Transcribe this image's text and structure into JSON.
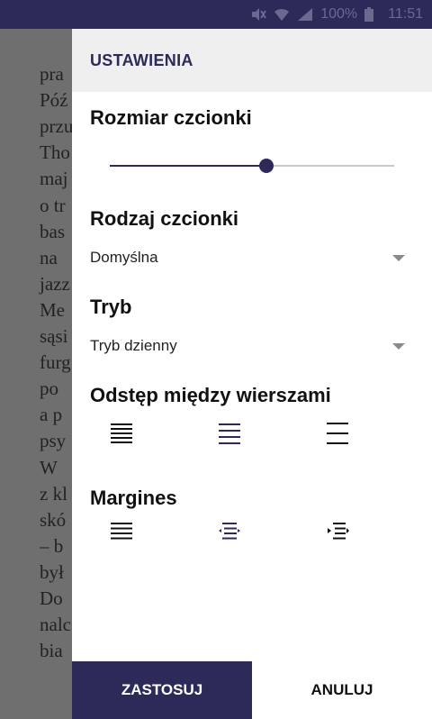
{
  "status_bar": {
    "battery": "100%",
    "time": "11:51"
  },
  "book": {
    "lines": [
      "pra",
      "Póź",
      "przu",
      "Tho",
      "maj",
      "o tr",
      "bas",
      "na",
      "jazz",
      "Me",
      "sąsi",
      "furg",
      "po",
      "a p",
      "psy",
      " W",
      "z kl",
      "skó",
      "– b",
      "był",
      "Do",
      "nalc",
      "bia"
    ]
  },
  "dialog": {
    "title": "USTAWIENIA",
    "font_size": {
      "label": "Rozmiar czcionki",
      "value_fraction": 0.55
    },
    "font_type": {
      "label": "Rodzaj czcionki",
      "selected": "Domyślna"
    },
    "mode": {
      "label": "Tryb",
      "selected": "Tryb dzienny"
    },
    "line_spacing": {
      "label": "Odstęp między wierszami",
      "options": [
        "line-spacing-small-icon",
        "line-spacing-medium-icon",
        "line-spacing-large-icon"
      ]
    },
    "margins": {
      "label": "Margines",
      "options": [
        "margin-none-icon",
        "margin-medium-icon",
        "margin-large-icon"
      ]
    },
    "apply_label": "ZASTOSUJ",
    "cancel_label": "ANULUJ"
  },
  "colors": {
    "accent": "#2c2a58",
    "status_bar": "#2c2a58",
    "overlay": "#6f6f6f"
  }
}
